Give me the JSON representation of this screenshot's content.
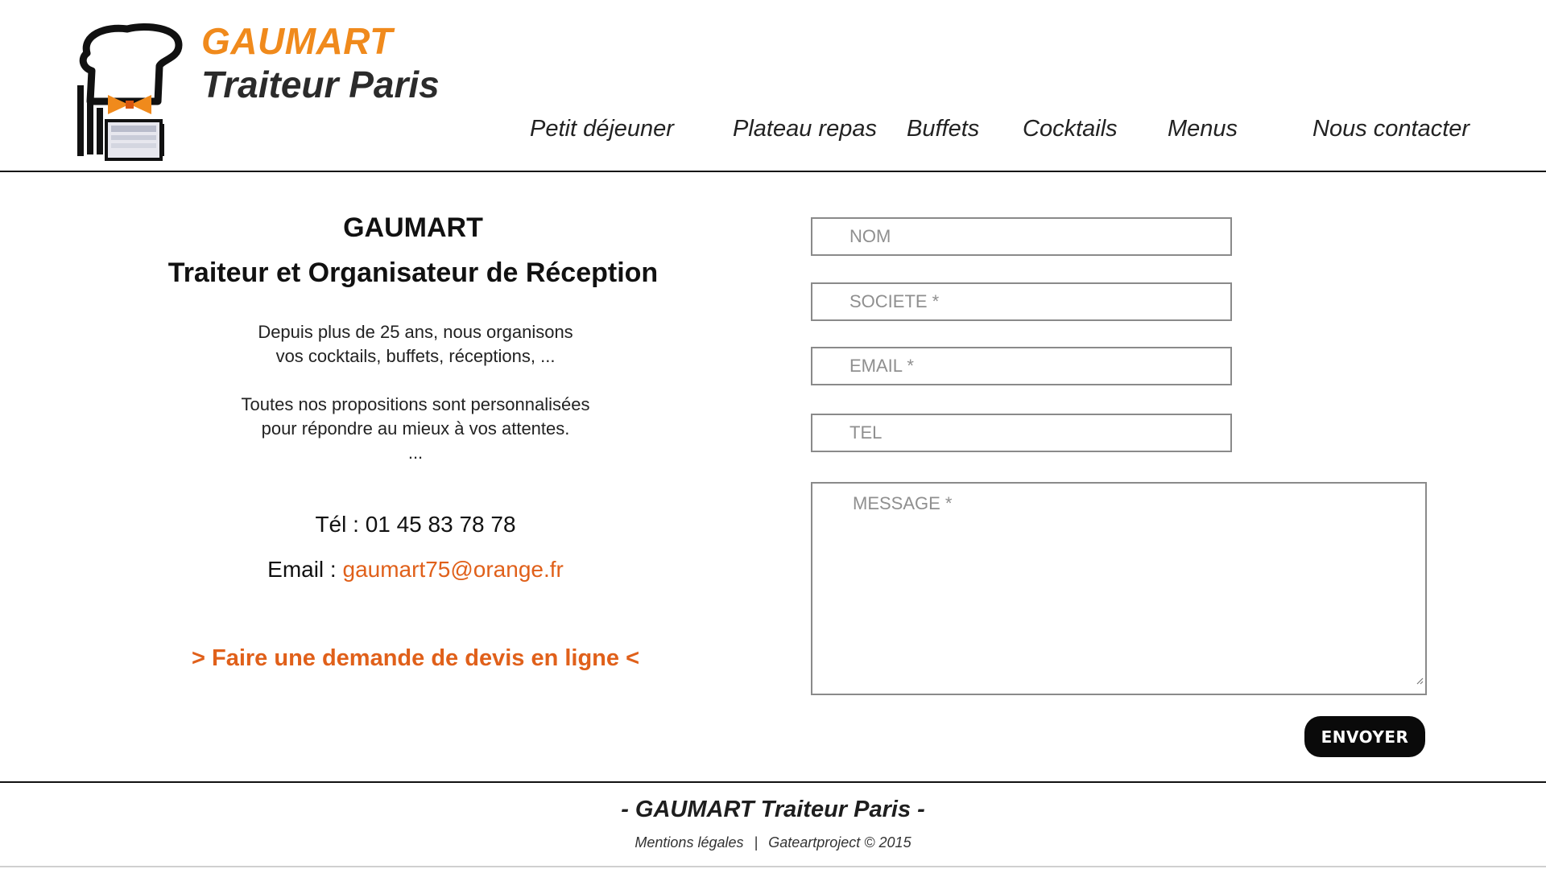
{
  "header": {
    "brand_line1": "GAUMART",
    "brand_line2": "Traiteur Paris",
    "logo_icon": "chef-hat-bowtie-icon",
    "nav": [
      {
        "label": "Petit déjeuner"
      },
      {
        "label": "Plateau repas"
      },
      {
        "label": "Buffets"
      },
      {
        "label": "Cocktails"
      },
      {
        "label": "Menus"
      },
      {
        "label": "Nous contacter"
      }
    ]
  },
  "info": {
    "title": "GAUMART",
    "subtitle": "Traiteur et Organisateur de Réception",
    "para1_line1": "Depuis plus de 25 ans, nous organisons",
    "para1_line2": "vos cocktails, buffets, réceptions, ...",
    "para2_line1": "Toutes nos propositions sont personnalisées",
    "para2_line2": "pour répondre au mieux à vos attentes.",
    "para2_line3": "...",
    "tel_text": "Tél : 01 45 83 78 78",
    "email_label": "Email : ",
    "email_value": "gaumart75@orange.fr",
    "devis_link": "> Faire une demande de devis en ligne <"
  },
  "form": {
    "nom_placeholder": "NOM",
    "societe_placeholder": "SOCIETE *",
    "email_placeholder": "EMAIL *",
    "tel_placeholder": "TEL",
    "message_placeholder": "MESSAGE *",
    "submit_label": "ENVOYER"
  },
  "footer": {
    "title": "- GAUMART Traiteur Paris -",
    "mentions": "Mentions légales",
    "separator": "|",
    "credit": "Gateartproject © 2015"
  },
  "colors": {
    "brand_orange": "#f08a1c",
    "link_orange": "#e0601a",
    "text_dark": "#111111",
    "button_black": "#0a0a0a"
  }
}
